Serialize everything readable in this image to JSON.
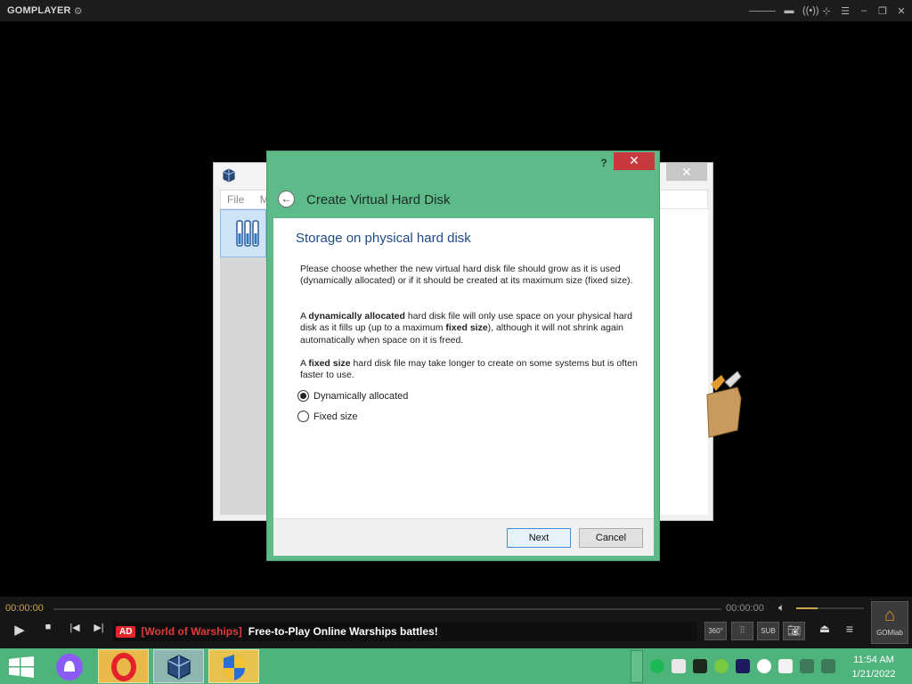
{
  "player": {
    "brand": "GOMPLAYER",
    "gear_icon": "gear-icon",
    "time_elapsed": "00:00:00",
    "time_total": "00:00:00",
    "volume_fraction": 0.32,
    "ad_badge": "AD",
    "ad_sponsor": "[World of Warships]",
    "ad_text": "Free-to-Play Online Warships battles!",
    "tools": [
      "360°",
      "",
      "SUB",
      ""
    ],
    "gomlab_label": "GOMlab"
  },
  "vbox_manager": {
    "menu": [
      "File",
      "M"
    ]
  },
  "dialog": {
    "help": "?",
    "close": "✕",
    "back": "←",
    "title": "Create Virtual Hard Disk",
    "heading": "Storage on physical hard disk",
    "para1": "Please choose whether the new virtual hard disk file should grow as it is used (dynamically allocated) or if it should be created at its maximum size (fixed size).",
    "para2": {
      "a": "A ",
      "b": "dynamically allocated",
      "c": " hard disk file will only use space on your physical hard disk as it fills up (up to a maximum ",
      "d": "fixed size",
      "e": "), although it will not shrink again automatically when space on it is freed."
    },
    "para3": {
      "a": "A ",
      "b": "fixed size",
      "c": " hard disk file may take longer to create on some systems but is often faster to use."
    },
    "options": [
      {
        "label": "Dynamically allocated",
        "selected": true
      },
      {
        "label": "Fixed size",
        "selected": false
      }
    ],
    "next_label": "Next",
    "cancel_label": "Cancel"
  },
  "taskbar": {
    "time": "11:54 AM",
    "date": "1/21/2022",
    "accent": "#4fb37c"
  }
}
